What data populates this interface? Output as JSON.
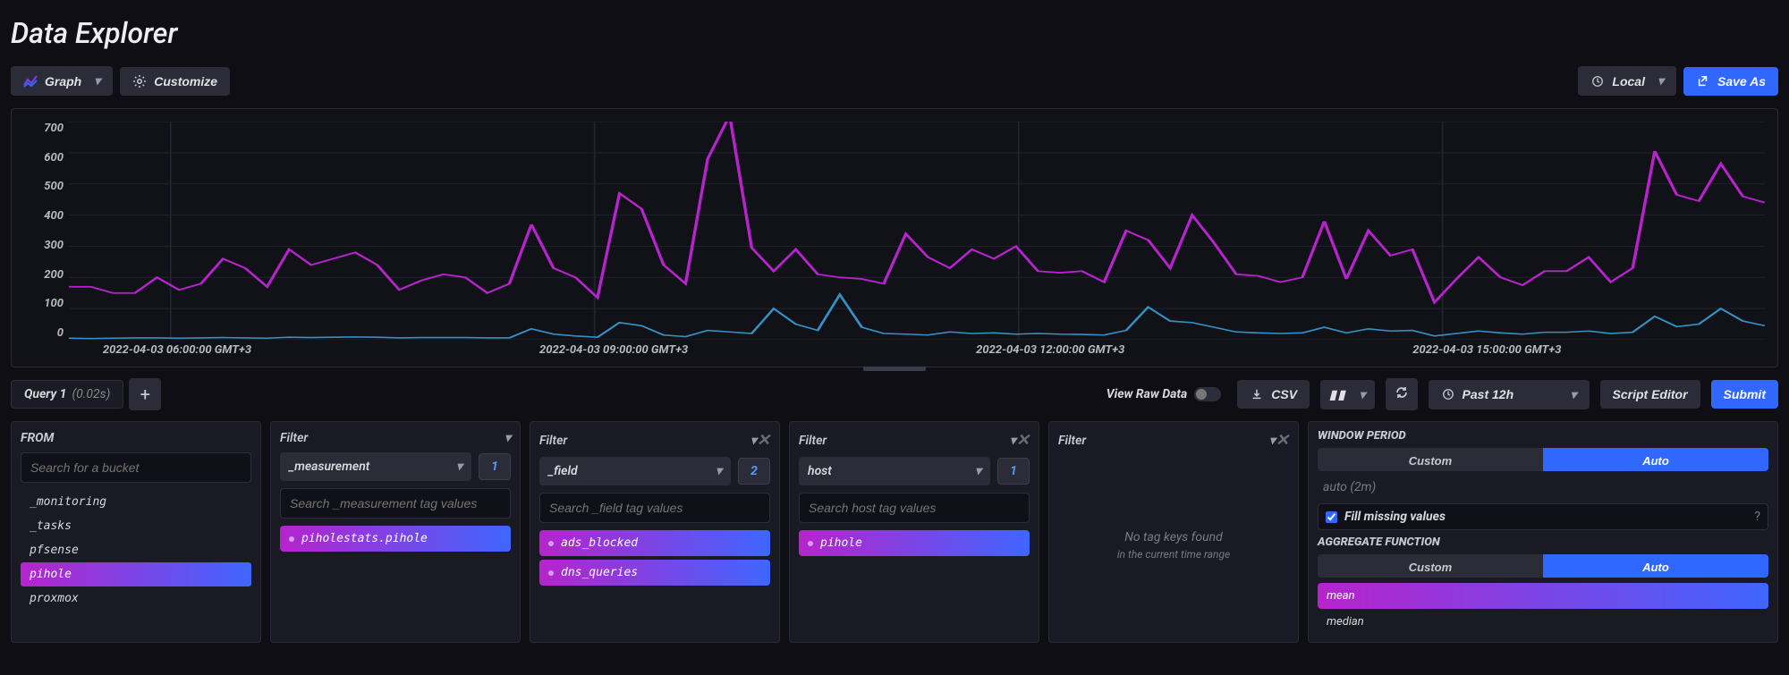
{
  "title": "Data Explorer",
  "toolbar": {
    "graph_label": "Graph",
    "customize_label": "Customize",
    "timezone_label": "Local",
    "save_as_label": "Save As"
  },
  "chart_data": {
    "type": "line",
    "xlabel": "",
    "ylabel": "",
    "ylim": [
      0,
      700
    ],
    "y_ticks": [
      700,
      600,
      500,
      400,
      300,
      200,
      100,
      0
    ],
    "x_ticks": [
      "2022-04-03 06:00:00 GMT+3",
      "2022-04-03 09:00:00 GMT+3",
      "2022-04-03 12:00:00 GMT+3",
      "2022-04-03 15:00:00 GMT+3"
    ],
    "series": [
      {
        "name": "dns_queries",
        "color": "#b723cc",
        "values": [
          170,
          170,
          150,
          150,
          200,
          160,
          180,
          260,
          230,
          170,
          290,
          240,
          260,
          280,
          240,
          160,
          190,
          210,
          200,
          150,
          180,
          370,
          230,
          200,
          135,
          470,
          420,
          240,
          180,
          580,
          720,
          295,
          220,
          290,
          210,
          200,
          195,
          180,
          340,
          265,
          230,
          290,
          260,
          300,
          220,
          215,
          220,
          185,
          350,
          320,
          230,
          400,
          310,
          210,
          205,
          185,
          200,
          380,
          195,
          350,
          270,
          290,
          120,
          195,
          265,
          200,
          175,
          220,
          220,
          265,
          185,
          230,
          605,
          465,
          445,
          565,
          460,
          440
        ]
      },
      {
        "name": "ads_blocked",
        "color": "#3aa0d8",
        "values": [
          5,
          4,
          5,
          6,
          6,
          5,
          6,
          7,
          6,
          5,
          8,
          7,
          8,
          9,
          8,
          6,
          7,
          7,
          7,
          6,
          6,
          35,
          18,
          12,
          8,
          55,
          45,
          15,
          10,
          30,
          25,
          20,
          100,
          50,
          30,
          145,
          40,
          20,
          18,
          15,
          25,
          20,
          22,
          18,
          20,
          18,
          17,
          15,
          30,
          105,
          60,
          55,
          40,
          25,
          22,
          20,
          22,
          40,
          22,
          35,
          28,
          30,
          12,
          20,
          28,
          22,
          18,
          24,
          24,
          28,
          20,
          24,
          75,
          42,
          50,
          100,
          60,
          45
        ]
      }
    ]
  },
  "query_tab": {
    "label": "Query 1",
    "timing": "(0.02s)"
  },
  "mid": {
    "view_raw": "View Raw Data",
    "csv": "CSV",
    "time_range": "Past 12h",
    "script_editor": "Script Editor",
    "submit": "Submit"
  },
  "from": {
    "header": "FROM",
    "search_placeholder": "Search for a bucket",
    "buckets": [
      "_monitoring",
      "_tasks",
      "pfsense",
      "pihole",
      "proxmox"
    ],
    "selected": "pihole"
  },
  "filters": [
    {
      "dropdown_label": "Filter",
      "tag_key": "_measurement",
      "count": "1",
      "search_placeholder": "Search _measurement tag values",
      "values": [
        {
          "label": "piholestats.pihole",
          "selected": true
        }
      ],
      "closable": false
    },
    {
      "dropdown_label": "Filter",
      "tag_key": "_field",
      "count": "2",
      "search_placeholder": "Search _field tag values",
      "values": [
        {
          "label": "ads_blocked",
          "selected": true
        },
        {
          "label": "dns_queries",
          "selected": true
        }
      ],
      "closable": true
    },
    {
      "dropdown_label": "Filter",
      "tag_key": "host",
      "count": "1",
      "search_placeholder": "Search host tag values",
      "values": [
        {
          "label": "pihole",
          "selected": true
        }
      ],
      "closable": true
    },
    {
      "dropdown_label": "Filter",
      "tag_key": "",
      "count": "",
      "empty_title": "No tag keys found",
      "empty_sub": "in the current time range",
      "values": [],
      "closable": true
    }
  ],
  "side": {
    "window_header": "WINDOW PERIOD",
    "custom": "Custom",
    "auto": "Auto",
    "window_value": "auto (2m)",
    "fill_missing": "Fill missing values",
    "agg_header": "AGGREGATE FUNCTION",
    "agg_funcs": [
      {
        "label": "mean",
        "selected": true
      },
      {
        "label": "median",
        "selected": false
      }
    ]
  }
}
